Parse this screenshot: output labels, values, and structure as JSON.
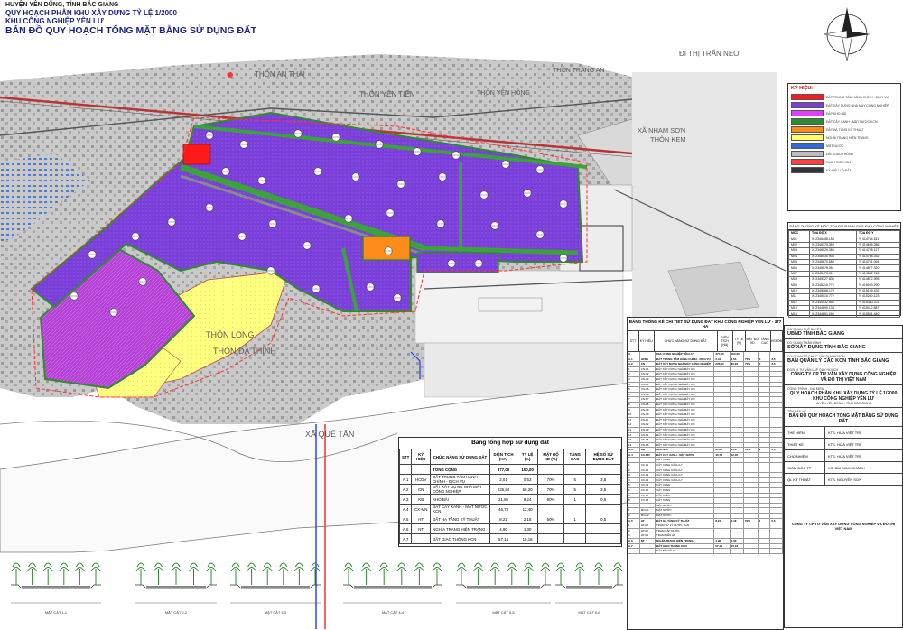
{
  "header": {
    "district": "HUYỆN YÊN DŨNG, TỈNH BẮC GIANG",
    "plan_title": "QUY HOẠCH PHÂN KHU XÂY DỰNG TỶ LỆ 1/2000",
    "zone_name": "KHU CÔNG NGHIỆP YÊN LƯ",
    "map_title": "BẢN ĐỒ QUY HOẠCH TỔNG MẶT BẰNG SỬ DỤNG ĐẤT"
  },
  "place_labels": {
    "thon_an_thai": "THÔN AN THÁI",
    "thon_yen_tien": "THÔN YÊN TIẾN",
    "thon_trang_an": "THÔN TRÀNG AN",
    "di_thi_tran_neo": "ĐI THỊ TRẤN NEO",
    "xa_nham_son": "XÃ NHAM SƠN",
    "thon_kem": "THÔN KEM",
    "thon_yen_hong": "THÔN YÊN HỒNG",
    "thon_long": "THÔN LONG",
    "thon_da_thinh": "THÔN ĐA THỊNH",
    "xa_que_tan": "XÃ QUẾ TÂN"
  },
  "legend": {
    "title": "KÝ HIỆU:",
    "items": [
      {
        "color": "#ff1a1a",
        "text": "ĐẤT TRUNG TÂM HÀNH CHÍNH - DỊCH VỤ"
      },
      {
        "color": "#7b3fd6",
        "text": "ĐẤT XÂY DỰNG NHÀ MÁY CÔNG NGHIỆP"
      },
      {
        "color": "#e040fb",
        "text": "ĐẤT KHO BÃI"
      },
      {
        "color": "#2e8b2e",
        "text": "ĐẤT CÂY XANH - MẶT NƯỚC KCN"
      },
      {
        "color": "#ff8c1a",
        "text": "ĐẤT HẠ TẦNG KỸ THUẬT"
      },
      {
        "color": "#ffff66",
        "text": "NGHĨA TRANG HIỆN TRẠNG"
      },
      {
        "color": "#2d6cdf",
        "text": "MẶT NƯỚC"
      },
      {
        "color": "#bdbdbd",
        "text": "ĐẤT GIAO THÔNG"
      },
      {
        "color": "#ff4040",
        "text": "RANH GIỚI KCN"
      },
      {
        "color": "#333333",
        "text": "KÝ HIỆU LÔ ĐẤT"
      }
    ]
  },
  "coords": {
    "title": "BẢNG THỐNG KÊ MỐC TỌA ĐỘ RANH GIỚI KHU CÔNG NGHIỆP",
    "head": [
      "MỐC",
      "TỌA ĐỘ X",
      "TỌA ĐỘ Y"
    ],
    "rows": [
      [
        "M01",
        "X: 2346458.154",
        "Y: 414734.511"
      ],
      [
        "M02",
        "X: 2346170.359",
        "Y: 414695.286"
      ],
      [
        "M03",
        "X: 2346029.385",
        "Y: 414728.127"
      ],
      [
        "M04",
        "X: 2346030.904",
        "Y: 414798.332"
      ],
      [
        "M05",
        "X: 2345670.588",
        "Y: 414791.094"
      ],
      [
        "M06",
        "X: 2345576.351",
        "Y: 414877.320"
      ],
      [
        "M07",
        "X: 2345473.611",
        "Y: 414882.765"
      ],
      [
        "M08",
        "X: 2345327.830",
        "Y: 414872.995"
      ],
      [
        "M09",
        "X: 2345210.775",
        "Y: 415003.290"
      ],
      [
        "M10",
        "X: 2345068.170",
        "Y: 415169.432"
      ],
      [
        "M11",
        "X: 2345010.772",
        "Y: 415280.123"
      ],
      [
        "M12",
        "X: 2344932.554",
        "Y: 415340.221"
      ],
      [
        "M13",
        "X: 2344890.134",
        "Y: 415412.887"
      ],
      [
        "M14",
        "X: 2344851.090",
        "Y: 415531.440"
      ]
    ]
  },
  "summary": {
    "caption": "Bảng tổng hợp sử dụng đất",
    "headers": [
      "STT",
      "KÝ HIỆU",
      "CHỨC NĂNG SỬ DỤNG ĐẤT",
      "DIỆN TÍCH (HA)",
      "TỶ LỆ (%)",
      "MẬT ĐỘ XD (%)",
      "TẦNG CAO",
      "HỆ SỐ SỬ DỤNG ĐẤT"
    ],
    "rows": [
      [
        "",
        "",
        "TỔNG CỘNG",
        "377,00",
        "100,00",
        "",
        "",
        ""
      ],
      [
        "A.1",
        "HCDV",
        "ĐẤT TRUNG TÂM HÀNH CHÍNH - DỊCH VỤ",
        "2,01",
        "0,53",
        "70%",
        "5",
        "3,5"
      ],
      [
        "A.2",
        "CN",
        "ĐẤT XÂY DỰNG NHÀ MÁY CÔNG NGHIỆP",
        "226,84",
        "60,20",
        "70%",
        "5",
        "3,5"
      ],
      [
        "A.3",
        "KB",
        "KHO BÃI",
        "31,85",
        "8,24",
        "60%",
        "1",
        "0,6"
      ],
      [
        "A.4",
        "CX-MN",
        "ĐẤT CÂY XANH - MẶT NƯỚC KCN",
        "46,73",
        "12,40",
        "",
        "",
        ""
      ],
      [
        "A.5",
        "HT",
        "ĐẤT HẠ TẦNG KỸ THUẬT",
        "8,21",
        "2,18",
        "50%",
        "1",
        "0,5"
      ],
      [
        "A.6",
        "NT",
        "NGHĨA TRANG HIỆN TRẠNG",
        "4,90",
        "1,30",
        "",
        "",
        ""
      ],
      [
        "A.7",
        "",
        "ĐẤT GIAO THÔNG KCN",
        "57,14",
        "15,16",
        "",
        "",
        ""
      ]
    ]
  },
  "detail": {
    "caption": "BẢNG THỐNG KÊ CHI TIẾT SỬ DỤNG ĐẤT KHU CÔNG NGHIỆP YÊN LƯ - 377 HA",
    "headers": [
      "STT",
      "KÝ HIỆU",
      "CHỨC NĂNG SỬ DỤNG ĐẤT",
      "DIỆN TÍCH (HA)",
      "TỶ LỆ (%)",
      "MẬT ĐỘ XD",
      "TẦNG CAO",
      "HSSDĐ"
    ],
    "rows": [
      [
        "A",
        "",
        "KHU CÔNG NGHIỆP YÊN LƯ",
        "377,00",
        "100,00",
        "",
        "",
        ""
      ],
      [
        "A.1",
        "HCDV",
        "ĐẤT TRUNG TÂM HÀNH CHÍNH - DỊCH VỤ",
        "2,01",
        "0,53",
        "70%",
        "5",
        "3,5"
      ],
      [
        "A.2",
        "CN",
        "ĐẤT XÂY DỰNG NHÀ MÁY CÔNG NGHIỆP",
        "226,84",
        "60,20",
        "70%",
        "5",
        "3,5"
      ],
      [
        "1",
        "CN-01",
        "ĐẤT XÂY DỰNG NHÀ MÁY CN",
        "",
        "",
        "",
        "",
        ""
      ],
      [
        "2",
        "CN-02",
        "ĐẤT XÂY DỰNG NHÀ MÁY CN",
        "",
        "",
        "",
        "",
        ""
      ],
      [
        "3",
        "CN-03",
        "ĐẤT XÂY DỰNG NHÀ MÁY CN",
        "",
        "",
        "",
        "",
        ""
      ],
      [
        "4",
        "CN-04",
        "ĐẤT XÂY DỰNG NHÀ MÁY CN",
        "",
        "",
        "",
        "",
        ""
      ],
      [
        "5",
        "CN-05",
        "ĐẤT XÂY DỰNG NHÀ MÁY CN",
        "",
        "",
        "",
        "",
        ""
      ],
      [
        "6",
        "CN-06",
        "ĐẤT XÂY DỰNG NHÀ MÁY CN",
        "",
        "",
        "",
        "",
        ""
      ],
      [
        "7",
        "CN-07",
        "ĐẤT XÂY DỰNG NHÀ MÁY CN",
        "",
        "",
        "",
        "",
        ""
      ],
      [
        "8",
        "CN-08",
        "ĐẤT XÂY DỰNG NHÀ MÁY CN",
        "",
        "",
        "",
        "",
        ""
      ],
      [
        "9",
        "CN-09",
        "ĐẤT XÂY DỰNG NHÀ MÁY CN",
        "",
        "",
        "",
        "",
        ""
      ],
      [
        "10",
        "CN-10",
        "ĐẤT XÂY DỰNG NHÀ MÁY CN",
        "",
        "",
        "",
        "",
        ""
      ],
      [
        "11",
        "CN-11",
        "ĐẤT XÂY DỰNG NHÀ MÁY CN",
        "",
        "",
        "",
        "",
        ""
      ],
      [
        "12",
        "CN-12",
        "ĐẤT XÂY DỰNG NHÀ MÁY CN",
        "",
        "",
        "",
        "",
        ""
      ],
      [
        "13",
        "CN-13",
        "ĐẤT XÂY DỰNG NHÀ MÁY CN",
        "",
        "",
        "",
        "",
        ""
      ],
      [
        "14",
        "CN-14",
        "ĐẤT XÂY DỰNG NHÀ MÁY CN",
        "",
        "",
        "",
        "",
        ""
      ],
      [
        "15",
        "CN-15",
        "ĐẤT XÂY DỰNG NHÀ MÁY CN",
        "",
        "",
        "",
        "",
        ""
      ],
      [
        "16",
        "CN-16",
        "ĐẤT XÂY DỰNG NHÀ MÁY CN",
        "",
        "",
        "",
        "",
        ""
      ],
      [
        "A.3",
        "KB",
        "KHO BÃI",
        "31,85",
        "8,24",
        "60%",
        "1",
        "0,6"
      ],
      [
        "A.4",
        "CX-MN",
        "ĐẤT CÂY XANH - MẶT NƯỚC",
        "46,73",
        "12,40",
        "",
        "",
        ""
      ],
      [
        "",
        "",
        "CÂY XANH",
        "",
        "",
        "",
        "",
        ""
      ],
      [
        "1",
        "CX-01",
        "CÂY XANH CÁCH LY",
        "",
        "",
        "",
        "",
        ""
      ],
      [
        "2",
        "CX-02",
        "CÂY XANH CÁCH LY",
        "",
        "",
        "",
        "",
        ""
      ],
      [
        "3",
        "CX-03",
        "CÂY XANH CÁCH LY",
        "",
        "",
        "",
        "",
        ""
      ],
      [
        "4",
        "CX-04",
        "CÂY XANH CÁCH LY",
        "",
        "",
        "",
        "",
        ""
      ],
      [
        "5",
        "CX-05",
        "CÂY XANH",
        "",
        "",
        "",
        "",
        ""
      ],
      [
        "6",
        "CX-06",
        "CÂY XANH",
        "",
        "",
        "",
        "",
        ""
      ],
      [
        "7",
        "CX-07",
        "CÂY XANH",
        "",
        "",
        "",
        "",
        ""
      ],
      [
        "8",
        "CX-08",
        "CÂY XANH",
        "",
        "",
        "",
        "",
        ""
      ],
      [
        "",
        "",
        "MẶT NƯỚC",
        "",
        "",
        "",
        "",
        ""
      ],
      [
        "1",
        "MN-01",
        "MẶT NƯỚC",
        "",
        "",
        "",
        "",
        ""
      ],
      [
        "2",
        "MN-02",
        "MẶT NƯỚC",
        "",
        "",
        "",
        "",
        ""
      ],
      [
        "A.5",
        "HT",
        "ĐẤT HẠ TẦNG KỸ THUẬT",
        "8,21",
        "2,18",
        "50%",
        "1",
        "0,5"
      ],
      [
        "1",
        "HT-01",
        "TRẠM XỬ LÝ NƯỚC THẢI",
        "",
        "",
        "",
        "",
        ""
      ],
      [
        "2",
        "HT-02",
        "TRẠM CẤP NƯỚC",
        "",
        "",
        "",
        "",
        ""
      ],
      [
        "3",
        "HT-03",
        "TRẠM BIẾN ÁP",
        "",
        "",
        "",
        "",
        ""
      ],
      [
        "A.6",
        "NT",
        "NGHĨA TRANG HIỆN TRẠNG",
        "4,90",
        "1,30",
        "",
        "",
        ""
      ],
      [
        "A.7",
        "",
        "ĐẤT GIAO THÔNG KCN",
        "57,14",
        "15,16",
        "",
        "",
        ""
      ],
      [
        "",
        "",
        "ĐẤT BÃI ĐỖ XE",
        "",
        "",
        "",
        "",
        ""
      ]
    ]
  },
  "titleblock": {
    "s1_small": "CƠ QUAN PHÊ DUYỆT",
    "s1_bold": "UBND TỈNH BẮC GIANG",
    "s2_small": "CƠ QUAN THẨM ĐỊNH",
    "s2_bold": "SỞ XÂY DỰNG TỈNH BẮC GIANG",
    "s3_small": "CƠ QUAN TỔ CHỨC LẬP QUY HOẠCH",
    "s3_bold": "BAN QUẢN LÝ CÁC KCN TỈNH BẮC GIANG",
    "s4_small": "ĐƠN VỊ TƯ VẤN LẬP QUY HOẠCH",
    "s4_bold": "CÔNG TY CP TƯ VẤN XÂY DỰNG CÔNG NGHIỆP VÀ ĐÔ THỊ VIỆT NAM",
    "proj_small": "CÔNG TRÌNH - ĐỊA ĐIỂM",
    "proj_l1": "QUY HOẠCH PHÂN KHU XÂY DỰNG TỶ LỆ 1/2000",
    "proj_l2": "KHU CÔNG NGHIỆP YÊN LƯ",
    "proj_l3": "HUYỆN YÊN DŨNG - TỈNH BẮC GIANG",
    "drw_small": "TÊN BẢN VẼ",
    "drw": "BẢN ĐỒ QUY HOẠCH TỔNG MẶT BẰNG SỬ DỤNG ĐẤT",
    "sign_rows": [
      [
        "THỂ HIỆN",
        "KTS. HỨA VIỆT TRÍ"
      ],
      [
        "THIẾT KẾ",
        "KTS. HỨA VIỆT TRÍ"
      ],
      [
        "CHỦ NHIỆM",
        "KTS. HỨA VIỆT TRÍ"
      ],
      [
        "GIÁM ĐỐC TT",
        "KS. BÙI MINH KHÁNH"
      ],
      [
        "QL KỸ THUẬT",
        "KTS. NGUYỄN SƠN"
      ]
    ],
    "company_bottom": "CÔNG TY CP TƯ VẤN XÂY DỰNG CÔNG NGHIỆP VÀ ĐÔ THỊ VIỆT NAM"
  },
  "sections": [
    "MẶT CẮT 1-1",
    "MẶT CẮT 2-2",
    "MẶT CẮT 3-3",
    "MẶT CẮT 4-4",
    "MẶT CẮT 5-5",
    "MẶT CẮT 6-6"
  ]
}
